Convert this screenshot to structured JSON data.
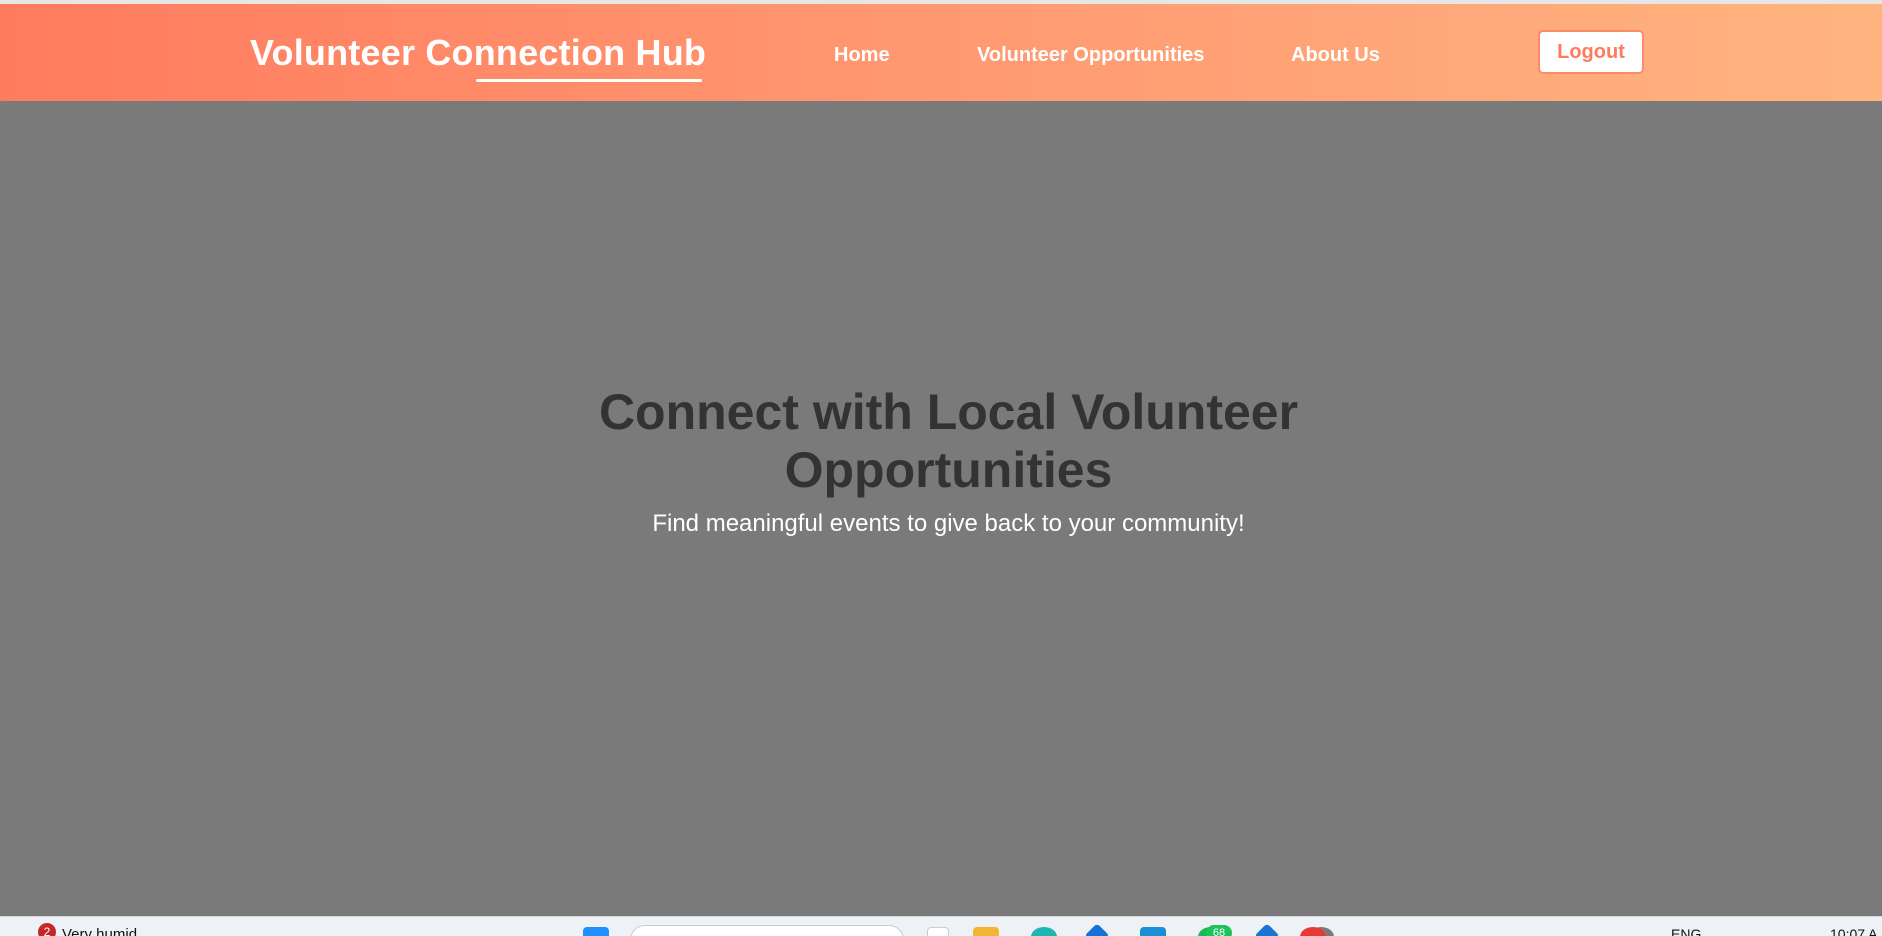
{
  "header": {
    "brand": "Volunteer Connection Hub",
    "nav": {
      "home": "Home",
      "opportunities": "Volunteer Opportunities",
      "about": "About Us"
    },
    "logout_label": "Logout"
  },
  "hero": {
    "title": "Connect with Local Volunteer Opportunities",
    "subtitle": "Find meaningful events to give back to your community!"
  },
  "taskbar": {
    "weather_badge": "2",
    "weather_text": "Very humid",
    "whatsapp_count": "68",
    "language": "ENG",
    "clock": "10:07 A"
  },
  "colors": {
    "header_gradient_start": "#ff7b5e",
    "header_gradient_end": "#ffb47f",
    "hero_background": "#7a7a7a",
    "hero_title": "#333333",
    "logout_text": "#ff7b5e"
  }
}
